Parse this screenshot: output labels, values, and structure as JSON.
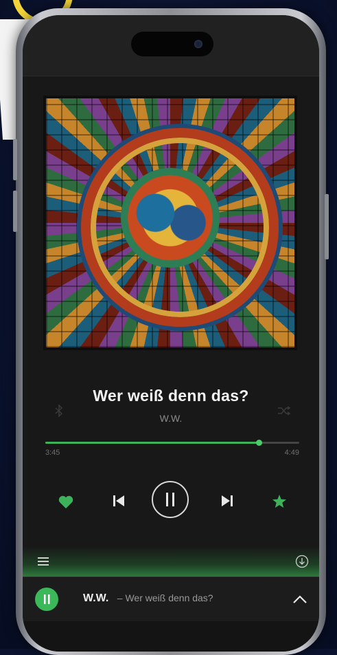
{
  "now_playing": {
    "title": "Wer weiß denn das?",
    "artist": "W.W.",
    "elapsed": "3:45",
    "duration": "4:49",
    "progress": 0.84
  },
  "controls": {
    "like_icon": "heart-icon",
    "previous_icon": "skip-previous-icon",
    "play_pause_icon": "pause-icon",
    "next_icon": "skip-next-icon",
    "favorite_icon": "star-icon"
  },
  "mini_player": {
    "artist": "W.W.",
    "separator_title": "– Wer weiß denn das?"
  },
  "colors": {
    "accent": "#3db25a",
    "background": "#181818",
    "text": "#f2f2f2",
    "muted": "#8b8b8b"
  }
}
